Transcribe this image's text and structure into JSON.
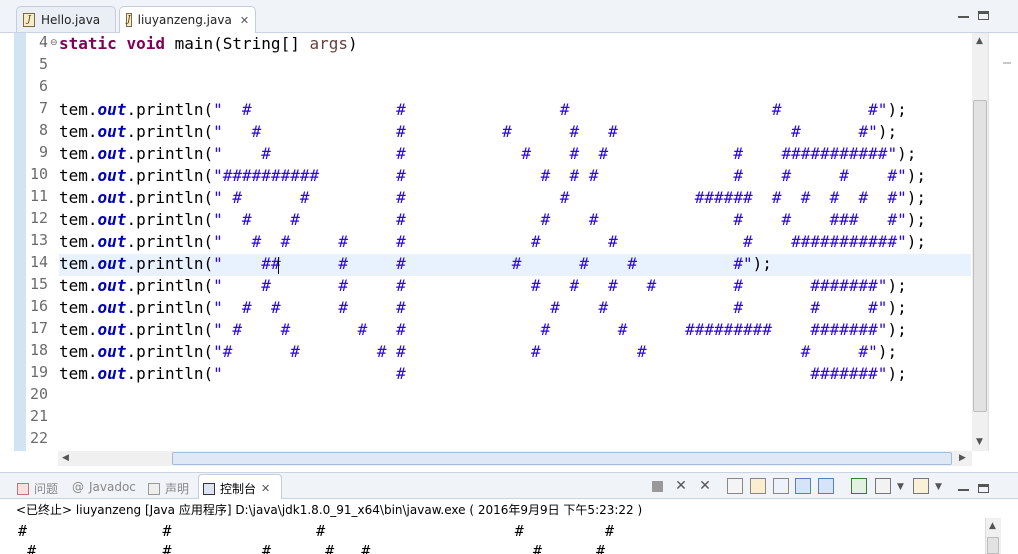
{
  "tabs": [
    {
      "label": "Hello.java",
      "active": false
    },
    {
      "label": "liuyanzeng.java",
      "active": true,
      "close": "✕"
    }
  ],
  "editor": {
    "line_numbers": [
      "4",
      "5",
      "6",
      "7",
      "8",
      "9",
      "10",
      "11",
      "12",
      "13",
      "14",
      "15",
      "16",
      "17",
      "18",
      "19",
      "20",
      "21",
      "22"
    ],
    "line4": {
      "kw1": "static",
      "kw2": "void",
      "rest": " main(String[] ",
      "arg": "args",
      "end": ")"
    },
    "print_prefix": "tem.",
    "print_field": "out",
    "print_method": ".println(",
    "print_suffix": ");",
    "strings": [
      "\"  #               #                #                     #         #\"",
      "\"   #              #          #      #   #                  #      #\"",
      "\"    #             #            #    #  #             #    ###########\"",
      "\"##########        #              #  # #              #    #     #    #\"",
      "\" #      #         #                #             ######  #  #  #  #  #\"",
      "\"  #    #          #              #    #              #    #    ###   #\"",
      "\"   #  #     #     #             #       #             #    ###########\"",
      "\"    ##      #     #           #      #    #          #\"",
      "\"    #       #     #             #   #   #   #        #       #######\"",
      "\"  #  #      #     #               #    #             #       #     #\"",
      "\" #    #       #   #              #       #      #########    #######\"",
      "\"#      #        # #             #          #                #     #\"",
      "\"                  #                                          #######\""
    ]
  },
  "views": {
    "problems": "问题",
    "javadoc": "Javadoc",
    "declaration": "声明",
    "console": "控制台",
    "console_close": "✕"
  },
  "console": {
    "description": "<已终止> liuyanzeng [Java 应用程序] D:\\java\\jdk1.8.0_91_x64\\bin\\javaw.exe ( 2016年9月9日 下午5:23:22 )",
    "output": [
      "  #               #                #                     #         #",
      "   #              #          #      #   #                  #      #"
    ]
  },
  "colors": {
    "keyword": "#7f0055",
    "field": "#0000c0",
    "string": "#2a00ff",
    "current_line": "#e8f2fe",
    "ruler": "#d2e4f3"
  }
}
